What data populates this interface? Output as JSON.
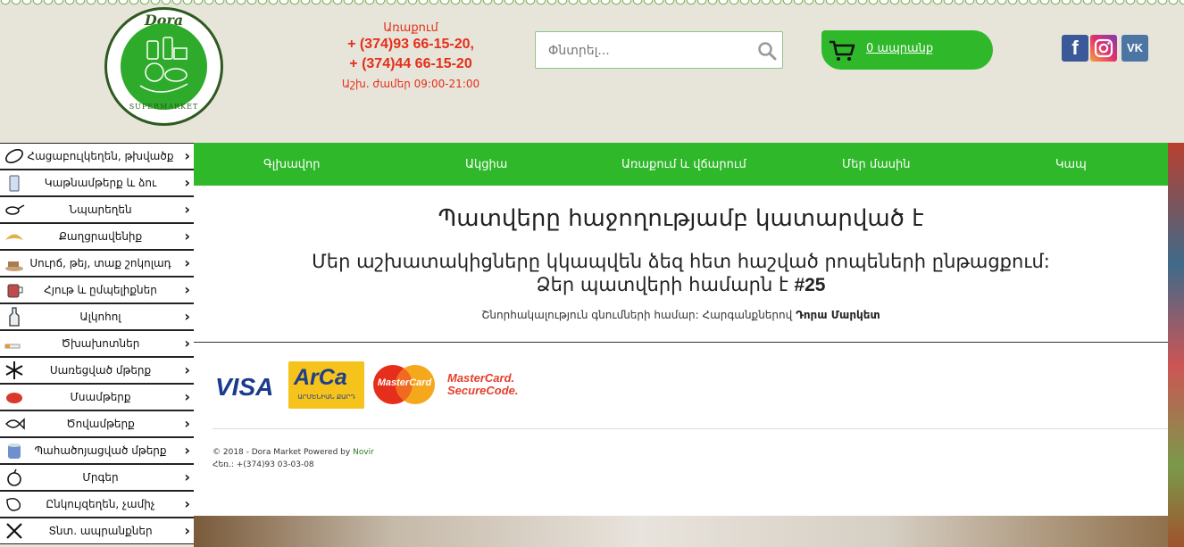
{
  "brand": {
    "logo_top": "Dora",
    "logo_bottom": "SUPERMARKET"
  },
  "contact": {
    "label": "Առաքում",
    "phone1": "+ (374)93 66-15-20,",
    "phone2": "+ (374)44 66-15-20",
    "hours": "Աշխ. ժամեր 09:00-21:00"
  },
  "search": {
    "placeholder": "Փնտրել..."
  },
  "cart": {
    "label": "0 ապրանք"
  },
  "social": {
    "facebook": "f",
    "instagram": "",
    "vk": "VK"
  },
  "sidebar": {
    "items": [
      {
        "label": "Հացաբուլկեղեն, թխվածք",
        "icon": "bread-icon"
      },
      {
        "label": "Կաթնամթերք և ձու",
        "icon": "milk-icon"
      },
      {
        "label": "Նպարեղեն",
        "icon": "pan-icon"
      },
      {
        "label": "Քաղցրավենիք",
        "icon": "croissant-icon"
      },
      {
        "label": "Սուրճ, թեյ, տաք շոկոլադ",
        "icon": "coffee-icon"
      },
      {
        "label": "Հյութ և ըմպելիքներ",
        "icon": "juice-icon"
      },
      {
        "label": "Ալկոհոլ",
        "icon": "bottle-icon"
      },
      {
        "label": "Ծխախոտներ",
        "icon": "cigarette-icon"
      },
      {
        "label": "Սառեցված մթերք",
        "icon": "snowflake-icon"
      },
      {
        "label": "Մսամթերք",
        "icon": "meat-icon"
      },
      {
        "label": "Ծովամթերք",
        "icon": "fish-icon"
      },
      {
        "label": "Պահածոյացված մթերք",
        "icon": "can-icon"
      },
      {
        "label": "Մրգեր",
        "icon": "apple-icon"
      },
      {
        "label": "Ընկույզեղեն, չամիչ",
        "icon": "nuts-icon"
      },
      {
        "label": "Տնտ. ապրանքներ",
        "icon": "tools-icon"
      }
    ]
  },
  "nav": {
    "home": "Գլխավոր",
    "promo": "Ակցիա",
    "delivery": "Առաքում և վճարում",
    "about": "Մեր մասին",
    "contact": "Կապ"
  },
  "order": {
    "title": "Պատվերը հաջողությամբ կատարված է",
    "message": "Մեր աշխատակիցները կկապվեն ձեզ հետ հաշված րոպեների ընթացքում:",
    "number_prefix": "Ձեր պատվերի համարն է",
    "number": "#25",
    "thanks": "Շնորհակալություն գնումների համար: Հարգանքներով",
    "thanks_sign": "Դորա Մարկետ"
  },
  "payments": {
    "visa": "VISA",
    "arca": "ArCa",
    "arca_sub": "ԱՐՄԵՆԻԱՆ ՔԱՐԴ",
    "mastercard": "MasterCard",
    "mc_secure1": "MasterCard.",
    "mc_secure2": "SecureCode."
  },
  "footer": {
    "copyright": "© 2018 - Dora Market Powered by",
    "powered": "Novir",
    "phone": "Հեռ.: +(374)93 03-03-08"
  },
  "colors": {
    "green": "#2eb82a",
    "red": "#e52e1b",
    "header_bg": "#e7e5d9"
  }
}
